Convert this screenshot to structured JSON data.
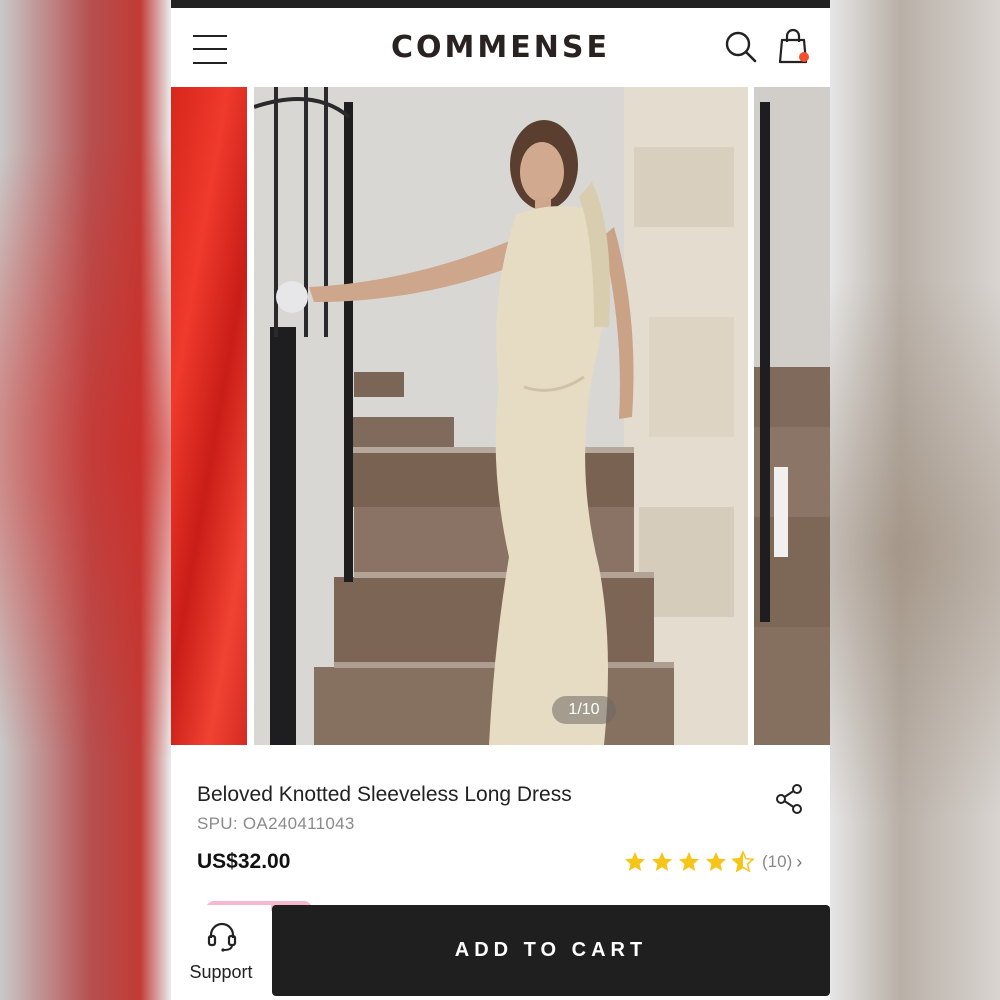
{
  "header": {
    "logo": "COMMENSE",
    "menu_icon": "hamburger-menu-icon",
    "search_icon": "search-icon",
    "bag_icon": "shopping-bag-icon",
    "badge_color": "#f2522e"
  },
  "gallery": {
    "counter": "1/10",
    "current": 1,
    "total": 10
  },
  "product": {
    "title": "Beloved Knotted Sleeveless Long Dress",
    "spu": "SPU: OA240411043",
    "price": "US$32.00",
    "rating": 4.5,
    "reviews": "(10)",
    "share_icon": "share-icon"
  },
  "footer": {
    "support_label": "Support",
    "support_icon": "headset-icon",
    "add_to_cart": "ADD TO CART"
  },
  "colors": {
    "accent_dark": "#1f1f1f",
    "star": "#f5c518",
    "badge_pink": "#f5b8cf"
  }
}
